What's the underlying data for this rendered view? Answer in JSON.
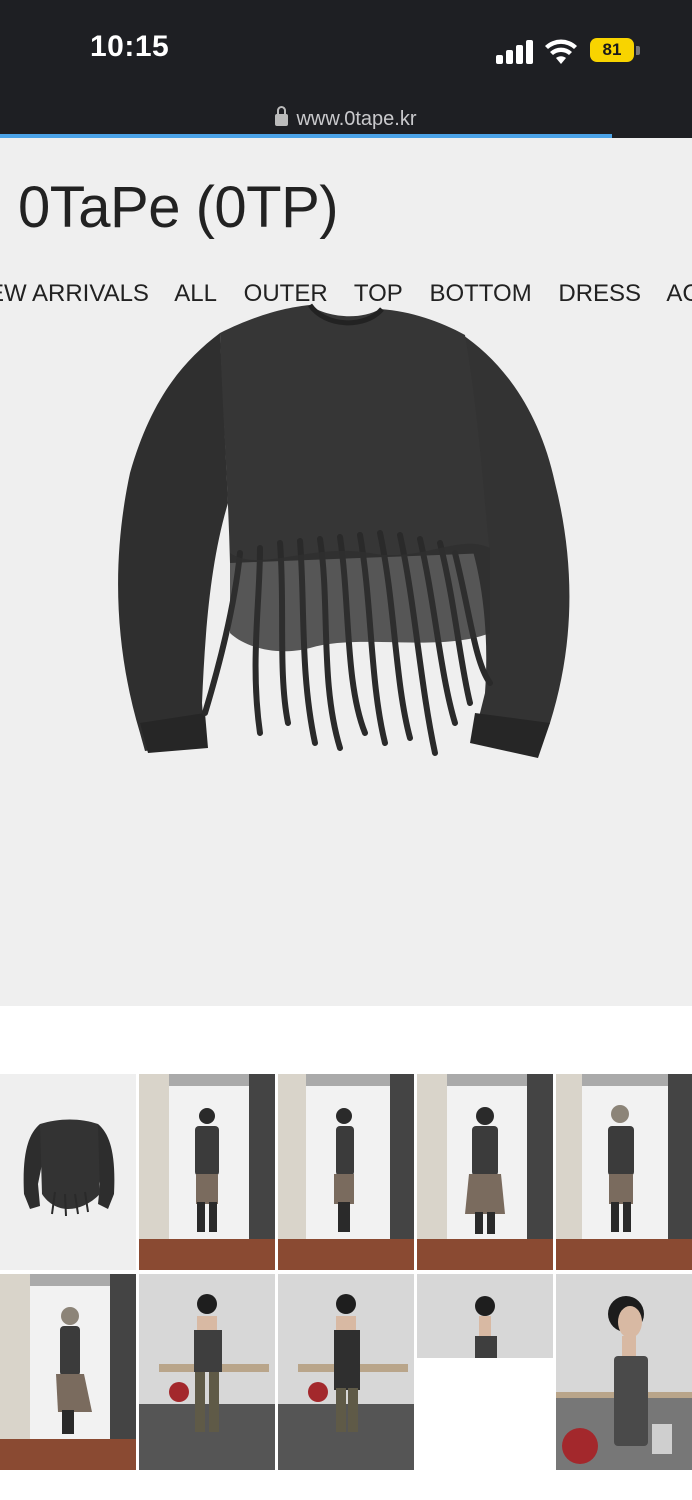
{
  "status_bar": {
    "time": "10:15",
    "battery": "81",
    "colors": {
      "background": "#1e1f23",
      "battery": "#f8d400"
    }
  },
  "browser": {
    "url": "www.0tape.kr",
    "load_progress": 0.885,
    "progress_color": "#4ba3e8"
  },
  "store": {
    "brand": "0TaPe (0TP)",
    "nav": [
      "EW ARRIVALS",
      "ALL",
      "OUTER",
      "TOP",
      "BOTTOM",
      "DRESS",
      "ACC"
    ]
  },
  "product": {
    "main_image": "dark-fringe-long-sleeve-top",
    "thumbnails": [
      {
        "kind": "flat-lay"
      },
      {
        "kind": "model-front"
      },
      {
        "kind": "model-side"
      },
      {
        "kind": "model-back"
      },
      {
        "kind": "model-front-hat"
      },
      {
        "kind": "model-side-hat"
      },
      {
        "kind": "model-front-tube"
      },
      {
        "kind": "model-back-tube"
      },
      {
        "kind": "model-side-tube-cropped"
      },
      {
        "kind": "model-profile-tube"
      }
    ]
  }
}
